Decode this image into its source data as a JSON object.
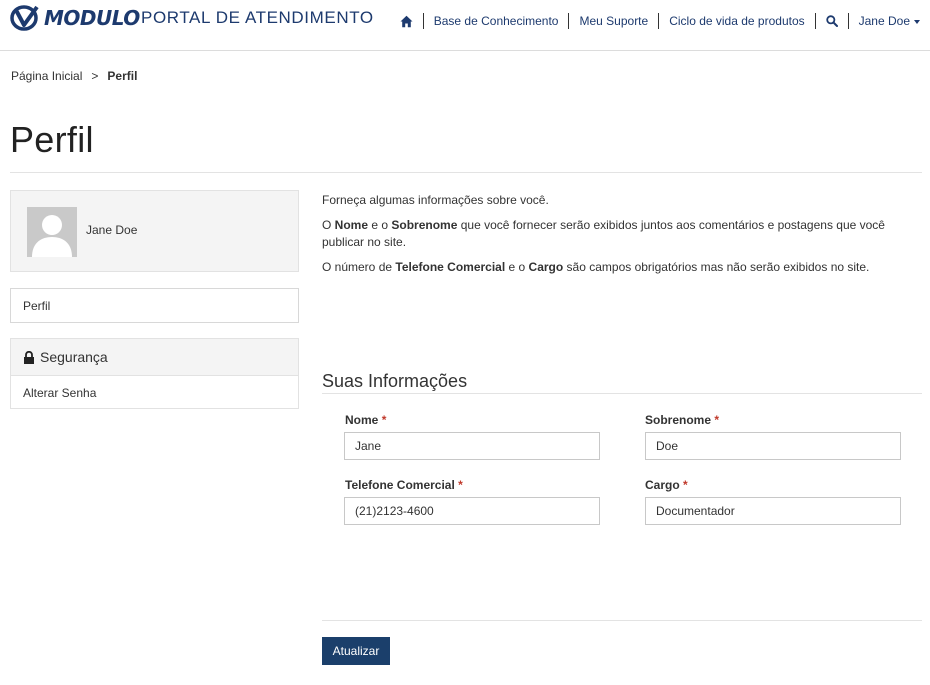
{
  "header": {
    "logo_text": "MODULO",
    "portal_title": "PORTAL DE ATENDIMENTO",
    "nav": [
      {
        "label": "Base de Conhecimento"
      },
      {
        "label": "Meu Suporte"
      },
      {
        "label": "Ciclo de vida de produtos"
      }
    ],
    "user_menu": "Jane Doe",
    "icons": {
      "home": "home-icon",
      "search": "search-icon",
      "user_caret": "caret-down-icon"
    },
    "colors": {
      "brand": "#1d3a6e"
    }
  },
  "breadcrumb": {
    "home": "Página Inicial",
    "separator": ">",
    "current": "Perfil"
  },
  "page_title": "Perfil",
  "sidebar": {
    "profile_name": "Jane Doe",
    "menu_item": "Perfil",
    "security_heading": "Segurança",
    "security_link": "Alterar Senha"
  },
  "intro": {
    "p1": "Forneça algumas informações sobre você.",
    "p2_a": "O ",
    "p2_b": "Nome",
    "p2_c": " e o ",
    "p2_d": "Sobrenome",
    "p2_e": " que você fornecer serão exibidos juntos aos comentários e postagens que você publicar no site.",
    "p3_a": "O número de ",
    "p3_b": "Telefone Comercial",
    "p3_c": " e o ",
    "p3_d": "Cargo",
    "p3_e": " são campos obrigatórios mas não serão exibidos no site."
  },
  "form": {
    "section_title": "Suas Informações",
    "required_mark": "*",
    "first_name": {
      "label": "Nome",
      "value": "Jane"
    },
    "last_name": {
      "label": "Sobrenome",
      "value": "Doe"
    },
    "phone": {
      "label": "Telefone Comercial",
      "value": "(21)2123-4600"
    },
    "job_title": {
      "label": "Cargo",
      "value": "Documentador"
    },
    "submit_label": "Atualizar",
    "colors": {
      "button": "#1b3f6b",
      "required": "#c0392b"
    }
  }
}
